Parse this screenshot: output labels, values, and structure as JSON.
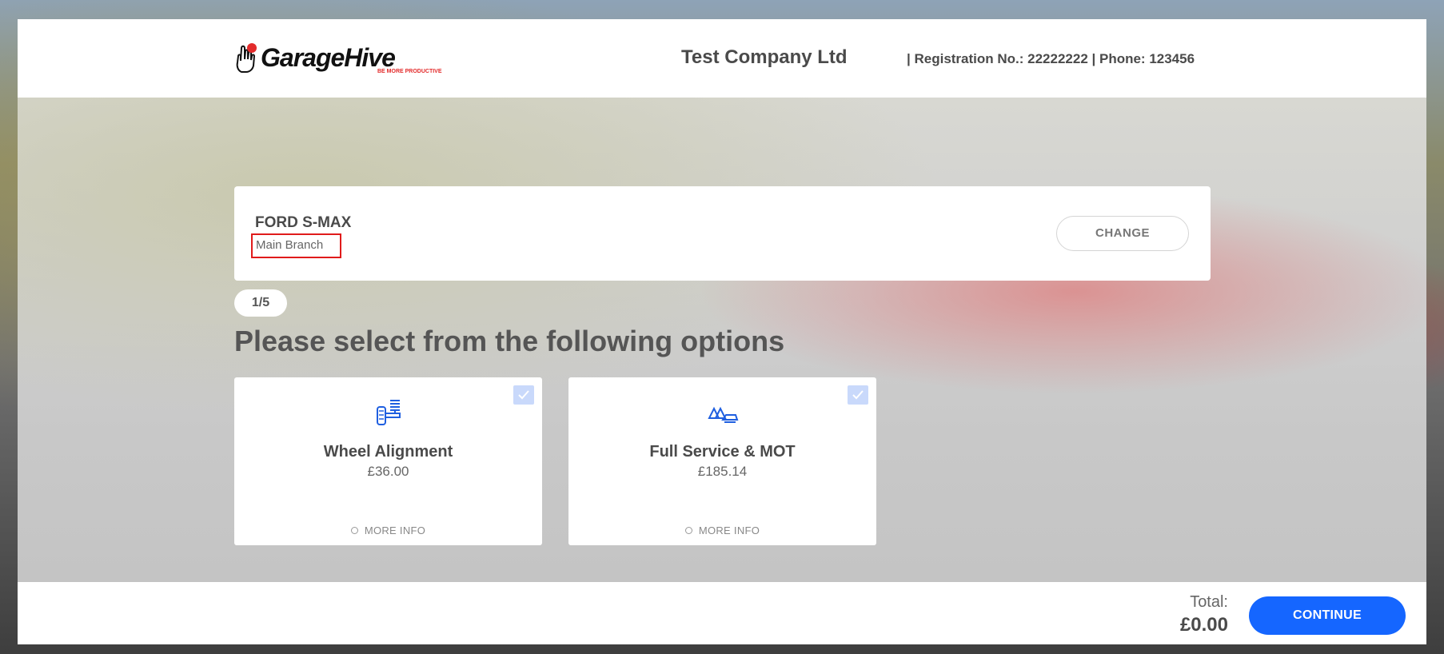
{
  "header": {
    "logo_text": "GarageHive",
    "logo_tagline": "BE MORE PRODUCTIVE",
    "company_name": "Test Company Ltd",
    "registration_info": "|  Registration No.: 22222222  |  Phone: 123456"
  },
  "vehicle": {
    "name": "FORD S-MAX",
    "branch": "Main Branch",
    "change_label": "CHANGE"
  },
  "step": {
    "indicator": "1/5",
    "heading": "Please select from the following options"
  },
  "options": [
    {
      "title": "Wheel Alignment",
      "price": "£36.00",
      "more_info": "MORE INFO",
      "icon": "wheel-alignment-icon",
      "checked": false
    },
    {
      "title": "Full Service & MOT",
      "price": "£185.14",
      "more_info": "MORE INFO",
      "icon": "service-mot-icon",
      "checked": false
    }
  ],
  "footer": {
    "total_label": "Total:",
    "total_value": "£0.00",
    "continue_label": "CONTINUE"
  },
  "colors": {
    "accent": "#1566ff",
    "highlight_border": "#e01b1b",
    "checkbox": "#c9d9fb"
  }
}
